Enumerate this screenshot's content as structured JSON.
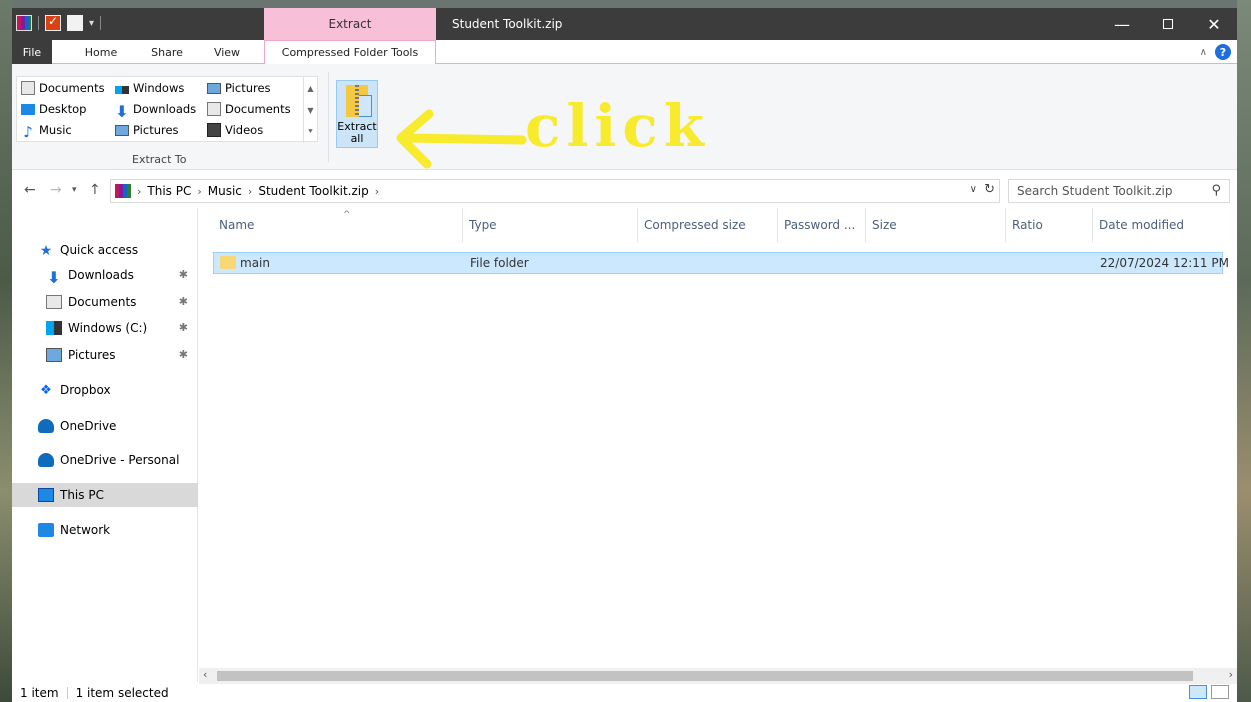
{
  "window": {
    "title": "Student Toolkit.zip",
    "context_tab_header": "Extract"
  },
  "ribbon": {
    "tabs": [
      "File",
      "Home",
      "Share",
      "View",
      "Compressed Folder Tools"
    ],
    "extract_to": {
      "items": [
        "Documents",
        "Windows",
        "Pictures",
        "Desktop",
        "Downloads",
        "Documents",
        "Music",
        "Pictures",
        "Videos"
      ],
      "label": "Extract To"
    },
    "extract_all": {
      "line1": "Extract",
      "line2": "all"
    }
  },
  "address": {
    "crumbs": [
      "This PC",
      "Music",
      "Student Toolkit.zip"
    ],
    "search_placeholder": "Search Student Toolkit.zip"
  },
  "navpane": {
    "items": [
      {
        "label": "Quick access",
        "icon": "star-icon"
      },
      {
        "label": "Downloads",
        "icon": "downloads-icon",
        "pinned": true
      },
      {
        "label": "Documents",
        "icon": "documents-icon",
        "pinned": true
      },
      {
        "label": "Windows (C:)",
        "icon": "drive-icon",
        "pinned": true
      },
      {
        "label": "Pictures",
        "icon": "pictures-icon",
        "pinned": true
      },
      {
        "label": "Dropbox",
        "icon": "dropbox-icon"
      },
      {
        "label": "OneDrive",
        "icon": "onedrive-icon"
      },
      {
        "label": "OneDrive - Personal",
        "icon": "onedrive-icon"
      },
      {
        "label": "This PC",
        "icon": "computer-icon",
        "selected": true
      },
      {
        "label": "Network",
        "icon": "network-icon"
      }
    ]
  },
  "filelist": {
    "columns": [
      "Name",
      "Type",
      "Compressed size",
      "Password ...",
      "Size",
      "Ratio",
      "Date modified"
    ],
    "rows": [
      {
        "name": "main",
        "type": "File folder",
        "date": "22/07/2024 12:11 PM"
      }
    ]
  },
  "status": {
    "count": "1 item",
    "selected": "1 item selected"
  },
  "annotation": {
    "text": "click"
  },
  "colors": {
    "context_tab": "#f7c0d8",
    "selection": "#cce8ff",
    "titlebar": "#3c3c3c",
    "annotation": "#f8ea2c"
  }
}
